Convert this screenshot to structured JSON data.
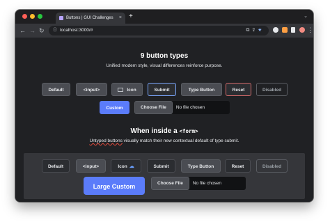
{
  "browser": {
    "tab_title": "Buttons | GUI Challenges",
    "tab_close": "×",
    "new_tab": "+",
    "tab_menu": "⌄",
    "url": "localhost:3000/#",
    "nav_back": "←",
    "nav_forward": "→",
    "nav_reload": "↻",
    "menu": "⋮"
  },
  "page": {
    "title": "9 button types",
    "subtitle": "Unified modern style, visual differences reinforce purpose.",
    "form_heading_prefix": "When inside a ",
    "form_heading_code": "<form>",
    "form_subtitle_underlined": "Untyped buttons",
    "form_subtitle_rest": " visually match their new contextual default of type submit."
  },
  "top_buttons": {
    "default": "Default",
    "input": "<input>",
    "icon": "Icon",
    "submit": "Submit",
    "type_button": "Type Button",
    "reset": "Reset",
    "disabled": "Disabled",
    "custom": "Custom",
    "choose_file": "Choose File",
    "no_file": "No file chosen"
  },
  "form_buttons": {
    "default": "Default",
    "input": "<input>",
    "icon": "Icon",
    "submit": "Submit",
    "type_button": "Type Button",
    "reset": "Reset",
    "disabled": "Disabled",
    "large_custom": "Large Custom",
    "choose_file": "Choose File",
    "no_file": "No file chosen"
  },
  "colors": {
    "accent": "#5b7cfa",
    "background": "#202124",
    "panel": "#35363a",
    "submit_outline": "#7aa7ff",
    "reset_outline": "#d46a6a"
  }
}
